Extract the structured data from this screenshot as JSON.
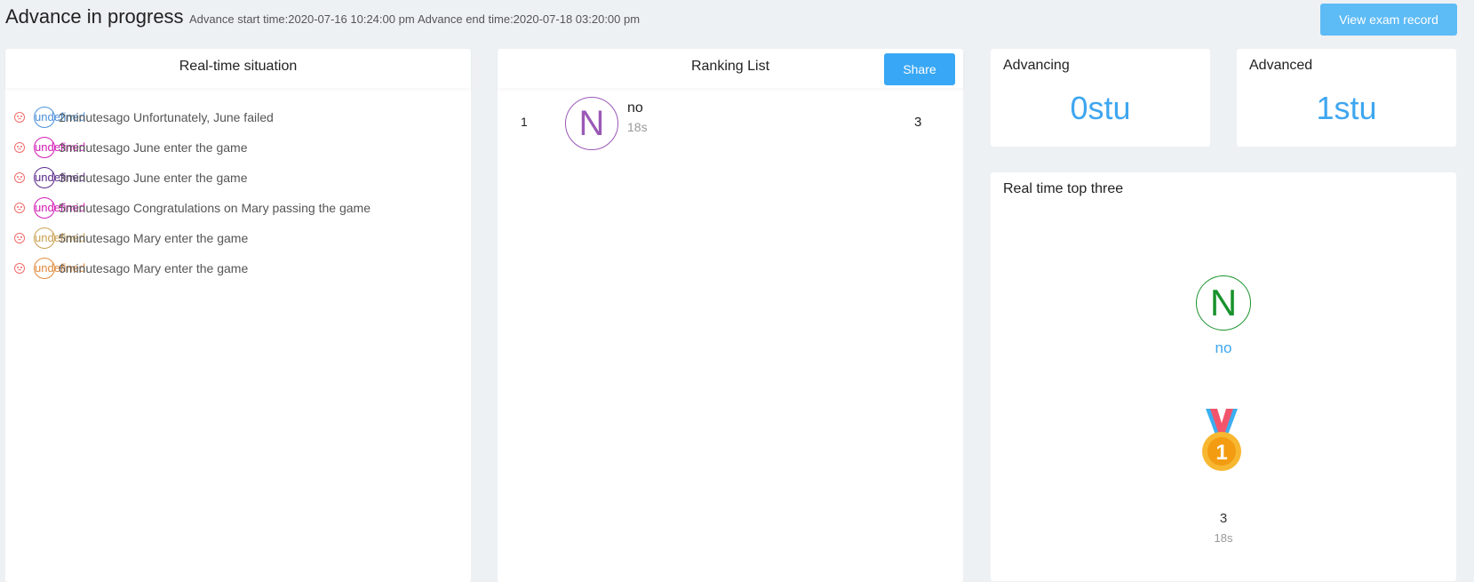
{
  "header": {
    "title": "Advance in progress",
    "start_time": "Advance start time:2020-07-16 10:24:00 pm",
    "end_time": "Advance end time:2020-07-18 03:20:00 pm",
    "view_record_label": "View exam record"
  },
  "realtime": {
    "title": "Real-time situation",
    "events": [
      {
        "avatar_text": "undefined",
        "avatar_color": "#4a90d9",
        "text": "2minutesago Unfortunately, June failed"
      },
      {
        "avatar_text": "undefined",
        "avatar_color": "#d21bb4",
        "text": "3minutesago June enter the game"
      },
      {
        "avatar_text": "undefined",
        "avatar_color": "#5b2a8a",
        "text": "3minutesago June enter the game"
      },
      {
        "avatar_text": "undefined",
        "avatar_color": "#d21bb4",
        "text": "5minutesago Congratulations on Mary passing the game"
      },
      {
        "avatar_text": "undefined",
        "avatar_color": "#c8a050",
        "text": "5minutesago Mary enter the game"
      },
      {
        "avatar_text": "undefined",
        "avatar_color": "#e08a3c",
        "text": "6minutesago Mary enter the game"
      }
    ]
  },
  "ranking": {
    "title": "Ranking List",
    "share_label": "Share",
    "rows": [
      {
        "rank": "1",
        "avatar_letter": "N",
        "name": "no",
        "time": "18s",
        "score": "3"
      }
    ]
  },
  "stats": {
    "advancing_label": "Advancing",
    "advancing_value": "0stu",
    "advanced_label": "Advanced",
    "advanced_value": "1stu"
  },
  "top_three": {
    "title": "Real time top three",
    "avatar_letter": "N",
    "name": "no",
    "score": "3",
    "time": "18s"
  },
  "colors": {
    "accent": "#3fa6f0",
    "button": "#38a7f5",
    "background": "#eef1f4",
    "sad": "#f26b6b"
  }
}
